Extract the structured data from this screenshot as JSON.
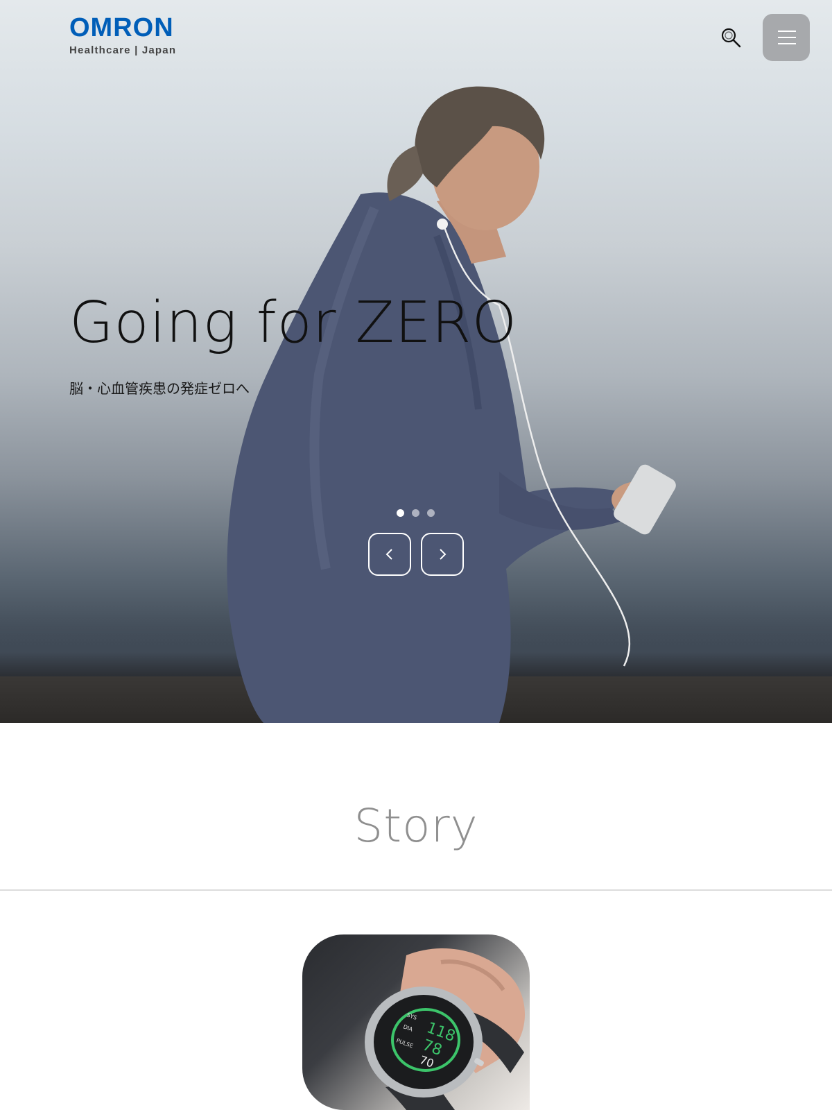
{
  "header": {
    "logo_text": "OMRON",
    "logo_subtitle": "Healthcare | Japan",
    "search_icon": "search-icon",
    "menu_icon": "hamburger-menu-icon"
  },
  "hero": {
    "title": "Going for ZERO",
    "subtitle": "脳・心血管疾患の発症ゼロへ",
    "slides_total": 3,
    "active_slide": 1,
    "prev_icon": "chevron-left-icon",
    "next_icon": "chevron-right-icon"
  },
  "story": {
    "heading": "Story",
    "card_image": "smartwatch-blood-pressure-image",
    "watch_readings": {
      "sys_label": "SYS",
      "dia_label": "DIA",
      "pulse_label": "PULSE",
      "sys": "118",
      "dia": "78",
      "pulse": "70"
    }
  },
  "colors": {
    "brand": "#005eb8",
    "menu_button": "#a7a9ac",
    "heading_gray": "#8f8f8f",
    "divider": "#dcdcdc",
    "watch_green": "#3cc46a"
  }
}
